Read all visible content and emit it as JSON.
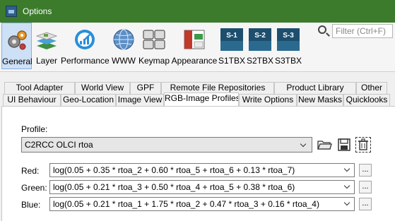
{
  "window": {
    "title": "Options"
  },
  "toolbar": {
    "items": [
      {
        "label": "General",
        "icon": "gear-icon"
      },
      {
        "label": "Layer",
        "icon": "layer-icon"
      },
      {
        "label": "Performance",
        "icon": "performance-icon"
      },
      {
        "label": "WWW",
        "icon": "globe-icon"
      },
      {
        "label": "Keymap",
        "icon": "keyboard-icon"
      },
      {
        "label": "Appearance",
        "icon": "appearance-icon"
      },
      {
        "label": "S1TBX",
        "icon": "s1-icon",
        "badge": "S-1"
      },
      {
        "label": "S2TBX",
        "icon": "s2-icon",
        "badge": "S-2"
      },
      {
        "label": "S3TBX",
        "icon": "s3-icon",
        "badge": "S-3"
      }
    ],
    "selected": "General"
  },
  "search": {
    "placeholder": "Filter (Ctrl+F)"
  },
  "tabs": {
    "row1": [
      "Tool Adapter",
      "World View",
      "GPF",
      "Remote File Repositories",
      "Product Library",
      "Other"
    ],
    "row2": [
      "UI Behaviour",
      "Geo-Location",
      "Image View",
      "RGB-Image Profiles",
      "Write Options",
      "New Masks",
      "Quicklooks"
    ],
    "active": "RGB-Image Profiles"
  },
  "profile": {
    "label": "Profile:",
    "value": "C2RCC OLCI rtoa"
  },
  "channels": [
    {
      "label": "Red:",
      "expression": "log(0.05 + 0.35 * rtoa_2 + 0.60 * rtoa_5 + rtoa_6 + 0.13 * rtoa_7)"
    },
    {
      "label": "Green:",
      "expression": "log(0.05 + 0.21 * rtoa_3 + 0.50 * rtoa_4 + rtoa_5 + 0.38 * rtoa_6)"
    },
    {
      "label": "Blue:",
      "expression": "log(0.05 + 0.21 * rtoa_1 + 1.75 * rtoa_2 + 0.47 * rtoa_3 + 0.16 * rtoa_4)"
    }
  ],
  "ellipsis_label": "...",
  "colors": {
    "titlebar": "#3c7b2b",
    "selected_bg": "#cde0f5"
  }
}
